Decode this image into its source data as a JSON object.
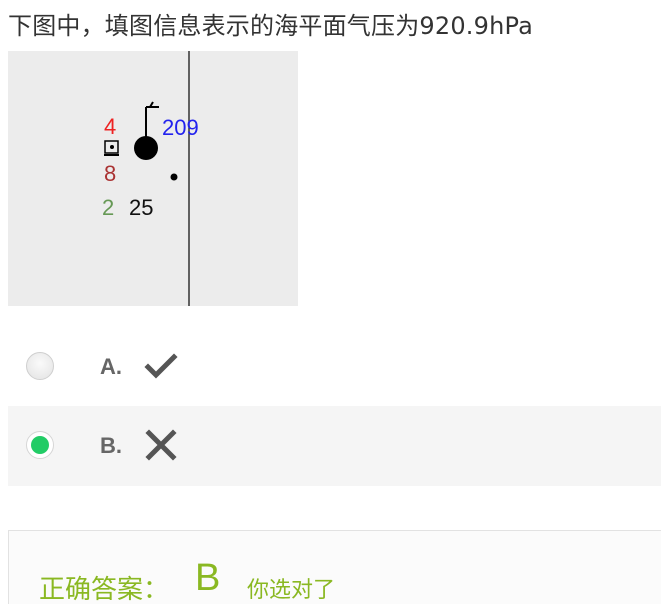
{
  "question": {
    "text": "下图中，填图信息表示的海平面气压为920.9hPa"
  },
  "station_plot": {
    "pressure": "209",
    "temperature_tendency": "4",
    "tendency_value": "8",
    "bottom_left_number": "2",
    "bottom_number": "25",
    "colors": {
      "red": "#ee2222",
      "blue": "#2222ee",
      "darkred": "#aa3333",
      "green": "#669955",
      "black": "#111111"
    }
  },
  "options": [
    {
      "letter": "A.",
      "icon": "check-icon",
      "selected": false
    },
    {
      "letter": "B.",
      "icon": "cross-icon",
      "selected": true
    }
  ],
  "answer": {
    "label": "正确答案：",
    "value": "B",
    "feedback": "你选对了",
    "color": "#8ab822"
  }
}
